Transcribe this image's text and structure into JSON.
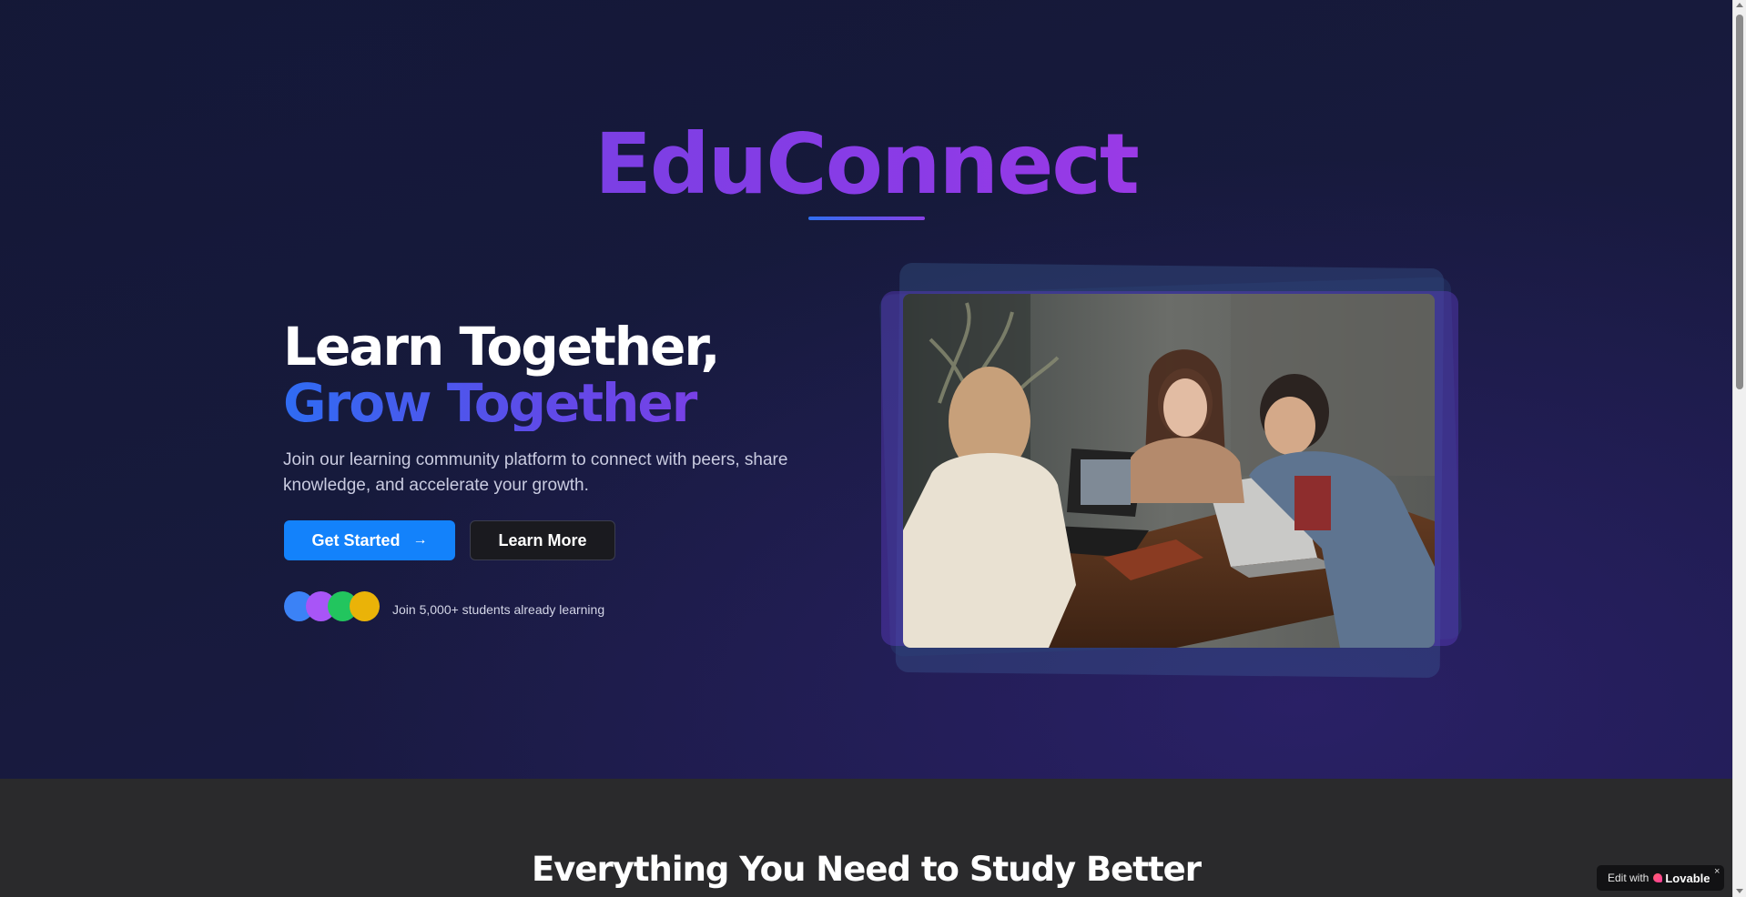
{
  "hero": {
    "brand": "EduConnect",
    "headline_line1": "Learn Together,",
    "headline_line2": "Grow Together",
    "subtitle": "Join our learning community platform to connect with peers, share knowledge, and accelerate your growth.",
    "primary_button": "Get Started",
    "primary_button_icon": "→",
    "secondary_button": "Learn More",
    "social_proof": "Join 5,000+ students already learning",
    "avatar_colors": [
      "#3b82f6",
      "#a855f7",
      "#22c55e",
      "#eab308"
    ]
  },
  "features": {
    "title": "Everything You Need to Study Better"
  },
  "badge": {
    "prefix": "Edit with",
    "brand": "Lovable",
    "close": "×"
  },
  "colors": {
    "accent_blue": "#1382fb",
    "brand_purple": "#8b3be6",
    "hero_bg": "#171a3c",
    "section_bg": "#2a2a2c"
  }
}
